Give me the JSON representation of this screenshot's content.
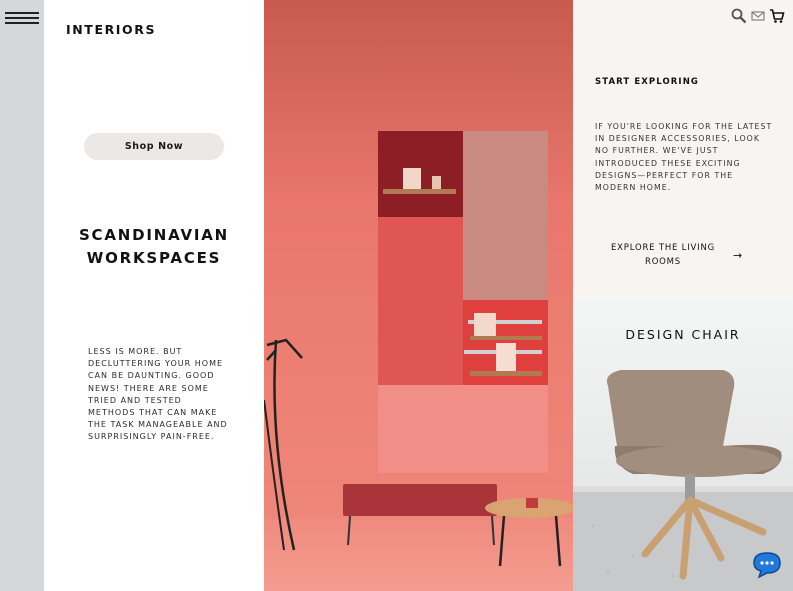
{
  "brand": "INTERIORS",
  "hero": {
    "shop_button": "Shop Now",
    "headline_line1": "SCANDINAVIAN",
    "headline_line2": "WORKSPACES",
    "blurb": "LESS IS MORE. BUT DECLUTTERING YOUR HOME CAN BE DAUNTING. GOOD NEWS! THERE ARE SOME TRIED AND TESTED METHODS THAT CAN MAKE THE TASK MANAGEABLE AND SURPRISINGLY PAIN-FREE."
  },
  "explore": {
    "title": "START EXPLORING",
    "text": "IF YOU'RE LOOKING FOR THE LATEST IN DESIGNER ACCESSORIES, LOOK NO FURTHER. WE'VE JUST INTRODUCED THESE EXCITING DESIGNS—PERFECT FOR THE MODERN HOME.",
    "link_line1": "EXPLORE THE LIVING",
    "link_line2": "ROOMS",
    "link_arrow": "→"
  },
  "feature": {
    "title": "DESIGN CHAIR"
  },
  "icons": [
    "menu-icon",
    "search-icon",
    "mail-icon",
    "cart-icon",
    "chat-icon"
  ],
  "colors": {
    "rail": "#d5d8da",
    "button_bg": "#ece8e6",
    "panel_bg": "#f8f4f2",
    "photo_wall": "#e8776d"
  }
}
